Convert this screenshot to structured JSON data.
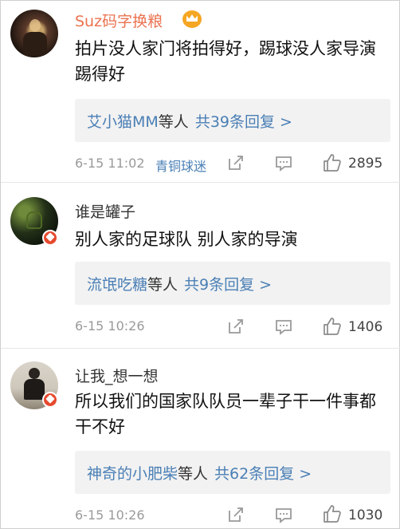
{
  "comments": [
    {
      "username": "Suz码字换粮",
      "text": "拍片没人家门将拍得好，踢球没人家导演踢得好",
      "reply_name": "艾小猫MM",
      "reply_mid": "等人",
      "reply_count": "共39条回复 >",
      "time": "6-15 11:02",
      "tag": "青铜球迷",
      "likes": "2895"
    },
    {
      "username": "谁是罐子",
      "text": "别人家的足球队 别人家的导演",
      "reply_name": "流氓吃糖",
      "reply_mid": "等人",
      "reply_count": "共9条回复 >",
      "time": "6-15 10:26",
      "likes": "1406"
    },
    {
      "username": "让我_想一想",
      "text": "所以我们的国家队队员一辈子干一件事都干不好",
      "reply_name": "神奇的小肥柴",
      "reply_mid": "等人",
      "reply_count": "共62条回复 >",
      "time": "6-15 10:26",
      "likes": "1030"
    }
  ],
  "icons": {
    "share": "share-icon",
    "comment": "comment-icon",
    "like": "thumbs-up-icon",
    "vip": "crown-icon",
    "verified": "verified-badge-icon"
  },
  "colors": {
    "link": "#4a7fb5",
    "vip_name": "#eb7350",
    "meta": "#9a9a9a",
    "reply_bg": "#f2f2f2"
  }
}
